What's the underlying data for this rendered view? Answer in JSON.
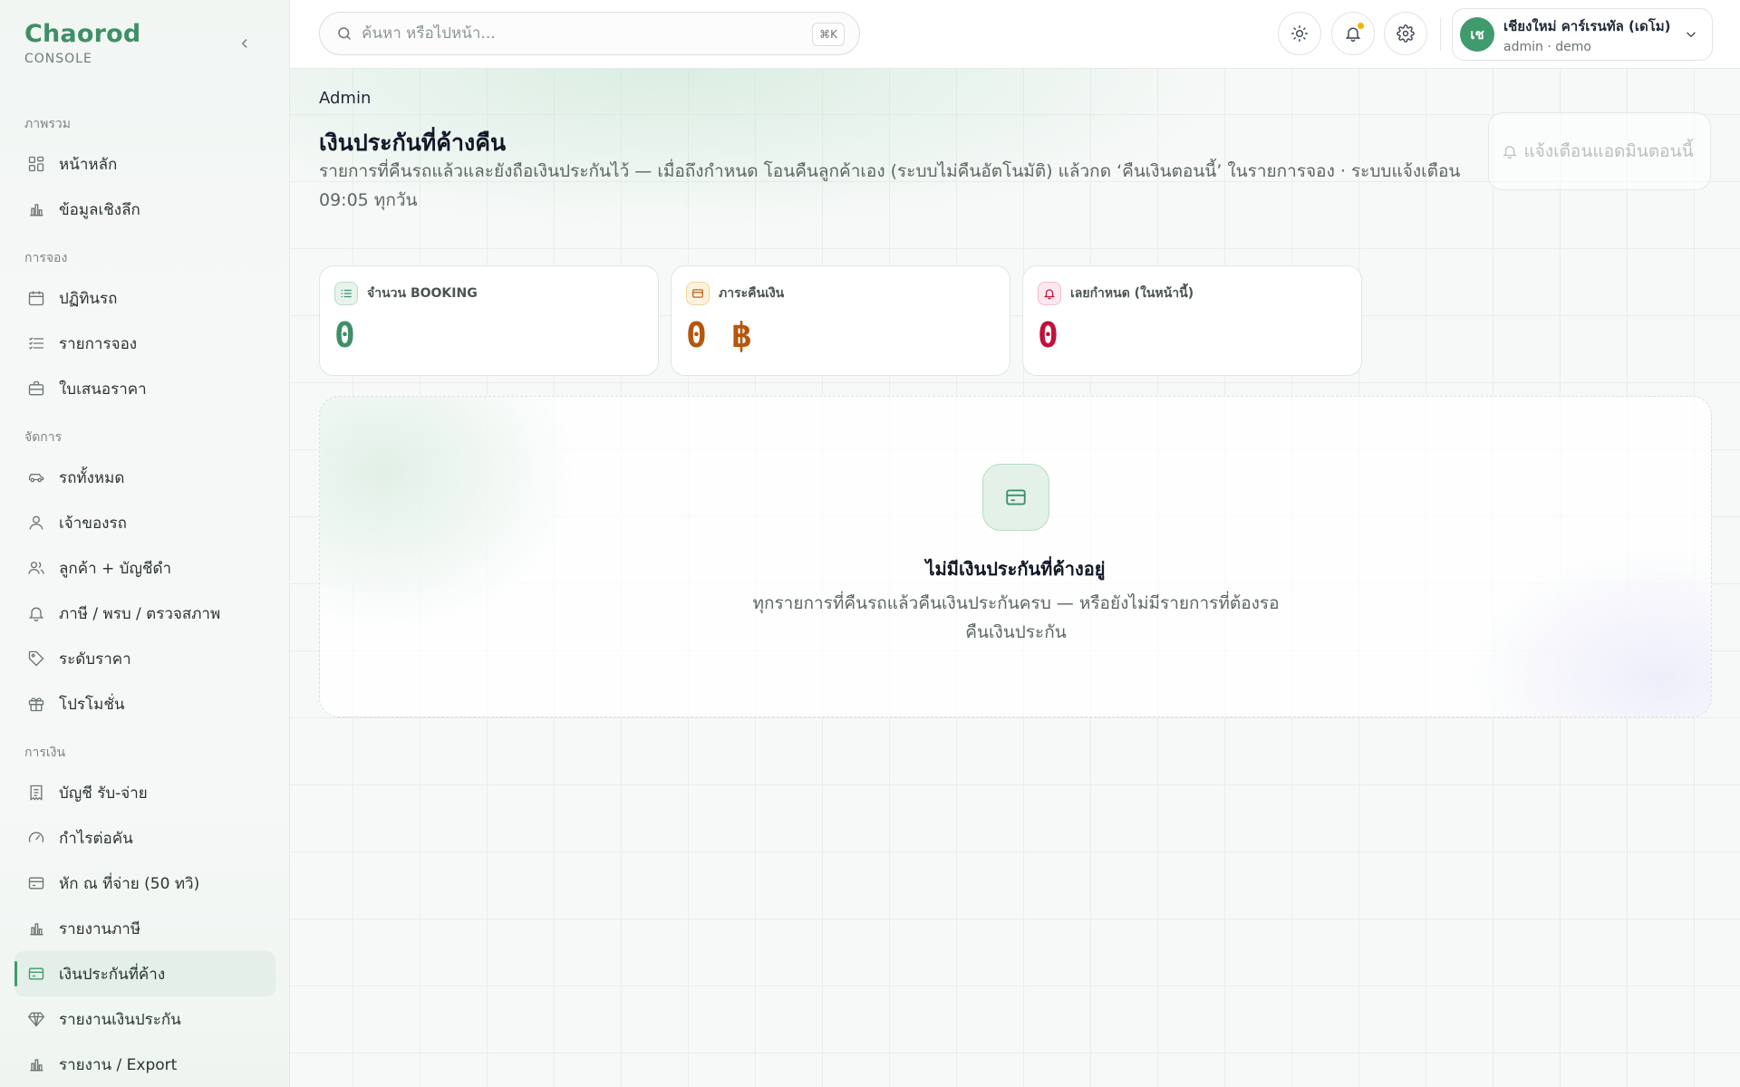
{
  "brand": {
    "name": "Chaorod",
    "subtitle": "CONSOLE"
  },
  "sidebar": {
    "sections": [
      {
        "title": "ภาพรวม",
        "items": [
          {
            "label": "หน้าหลัก",
            "icon": "dashboard-icon"
          },
          {
            "label": "ข้อมูลเชิงลึก",
            "icon": "bar-chart-icon"
          }
        ]
      },
      {
        "title": "การจอง",
        "items": [
          {
            "label": "ปฏิทินรถ",
            "icon": "calendar-icon"
          },
          {
            "label": "รายการจอง",
            "icon": "list-icon"
          },
          {
            "label": "ใบเสนอราคา",
            "icon": "briefcase-icon"
          }
        ]
      },
      {
        "title": "จัดการ",
        "items": [
          {
            "label": "รถทั้งหมด",
            "icon": "car-icon"
          },
          {
            "label": "เจ้าของรถ",
            "icon": "user-icon"
          },
          {
            "label": "ลูกค้า + บัญชีดำ",
            "icon": "users-icon"
          },
          {
            "label": "ภาษี / พรบ / ตรวจสภาพ",
            "icon": "bell-icon"
          },
          {
            "label": "ระดับราคา",
            "icon": "tag-icon"
          },
          {
            "label": "โปรโมชั่น",
            "icon": "gift-icon"
          }
        ]
      },
      {
        "title": "การเงิน",
        "items": [
          {
            "label": "บัญชี รับ-จ่าย",
            "icon": "receipt-icon"
          },
          {
            "label": "กำไรต่อคัน",
            "icon": "gauge-icon"
          },
          {
            "label": "หัก ณ ที่จ่าย (50 ทวิ)",
            "icon": "card-icon"
          },
          {
            "label": "รายงานภาษี",
            "icon": "bar-chart-icon"
          },
          {
            "label": "เงินประกันที่ค้าง",
            "icon": "wallet-icon",
            "active": true
          },
          {
            "label": "รายงานเงินประกัน",
            "icon": "diamond-icon"
          },
          {
            "label": "รายงาน / Export",
            "icon": "bar-chart-icon"
          }
        ]
      }
    ]
  },
  "topbar": {
    "search_placeholder": "ค้นหา หรือไปหน้า...",
    "search_shortcut": "⌘K",
    "account": {
      "initials": "เช",
      "name": "เชียงใหม่ คาร์เรนทัล (เดโม)",
      "role": "admin · demo"
    }
  },
  "page": {
    "breadcrumb": "Admin",
    "title": "เงินประกันที่ค้างคืน",
    "description": "รายการที่คืนรถแล้วและยังถือเงินประกันไว้ — เมื่อถึงกำหนด โอนคืนลูกค้าเอง (ระบบไม่คืนอัตโนมัติ) แล้วกด ‘คืนเงินตอนนี้’ ในรายการจอง · ระบบแจ้งเตือน 09:05 ทุกวัน",
    "notify_button": "แจ้งเตือนแอดมินตอนนี้"
  },
  "stats": [
    {
      "label": "จำนวน BOOKING",
      "value": "0",
      "color": "#3f8f66",
      "icon": "list-icon"
    },
    {
      "label": "ภาระคืนเงิน",
      "value": "0 ฿",
      "color": "#b4560c",
      "icon": "wallet-icon"
    },
    {
      "label": "เลยกำหนด (ในหน้านี้)",
      "value": "0",
      "color": "#be123c",
      "icon": "bell-icon"
    }
  ],
  "empty_state": {
    "title": "ไม่มีเงินประกันที่ค้างอยู่",
    "text": "ทุกรายการที่คืนรถแล้วคืนเงินประกันครบ — หรือยังไม่มีรายการที่ต้องรอคืนเงินประกัน"
  },
  "colors": {
    "accent": "#3f9a6c",
    "brand": "#3f8f66",
    "notification_dot": "#f5b400"
  }
}
